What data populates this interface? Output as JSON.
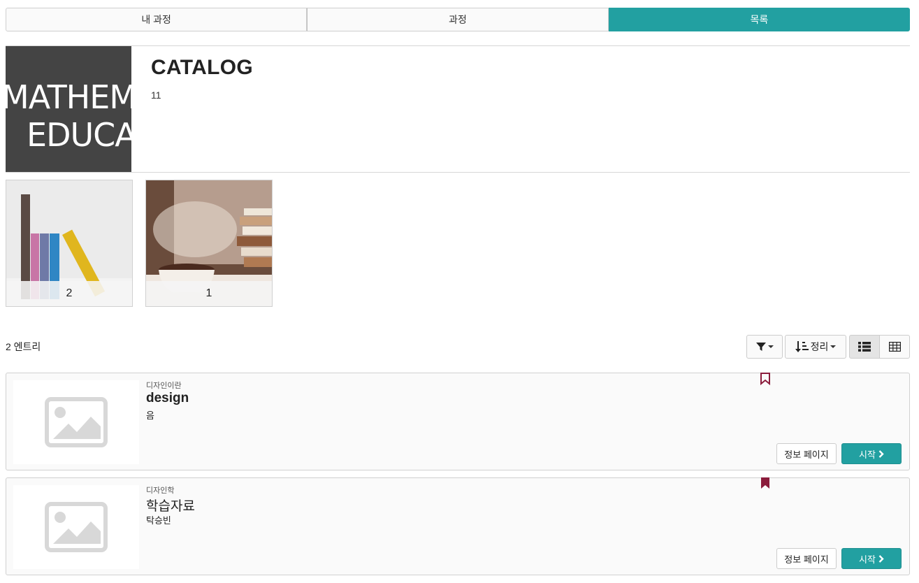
{
  "tabs": [
    {
      "label": "내 과정"
    },
    {
      "label": "과정"
    },
    {
      "label": "목록"
    }
  ],
  "catalog": {
    "image_text_line1": "MATHEM",
    "image_text_line2": "EDUCAT",
    "title": "CATALOG",
    "count": "11"
  },
  "subcatalogs": [
    {
      "count": "2"
    },
    {
      "count": "1"
    }
  ],
  "entries_label": "2 엔트리",
  "toolbar": {
    "filter_icon": "filter-icon",
    "sort_label": "정리",
    "sort_icon": "sort-amount-icon",
    "list_view_icon": "list-view-icon",
    "grid_view_icon": "grid-view-icon"
  },
  "courses": [
    {
      "category": "디자인이란",
      "title": "design",
      "author": "음",
      "bookmarked": false,
      "info_label": "정보 페이지",
      "start_label": "시작"
    },
    {
      "category": "디자인학",
      "title": "학습자료",
      "author": "탁승빈",
      "bookmarked": true,
      "info_label": "정보 페이지",
      "start_label": "시작"
    }
  ],
  "colors": {
    "accent": "#22a0a1",
    "bookmark": "#8b1c3c"
  }
}
